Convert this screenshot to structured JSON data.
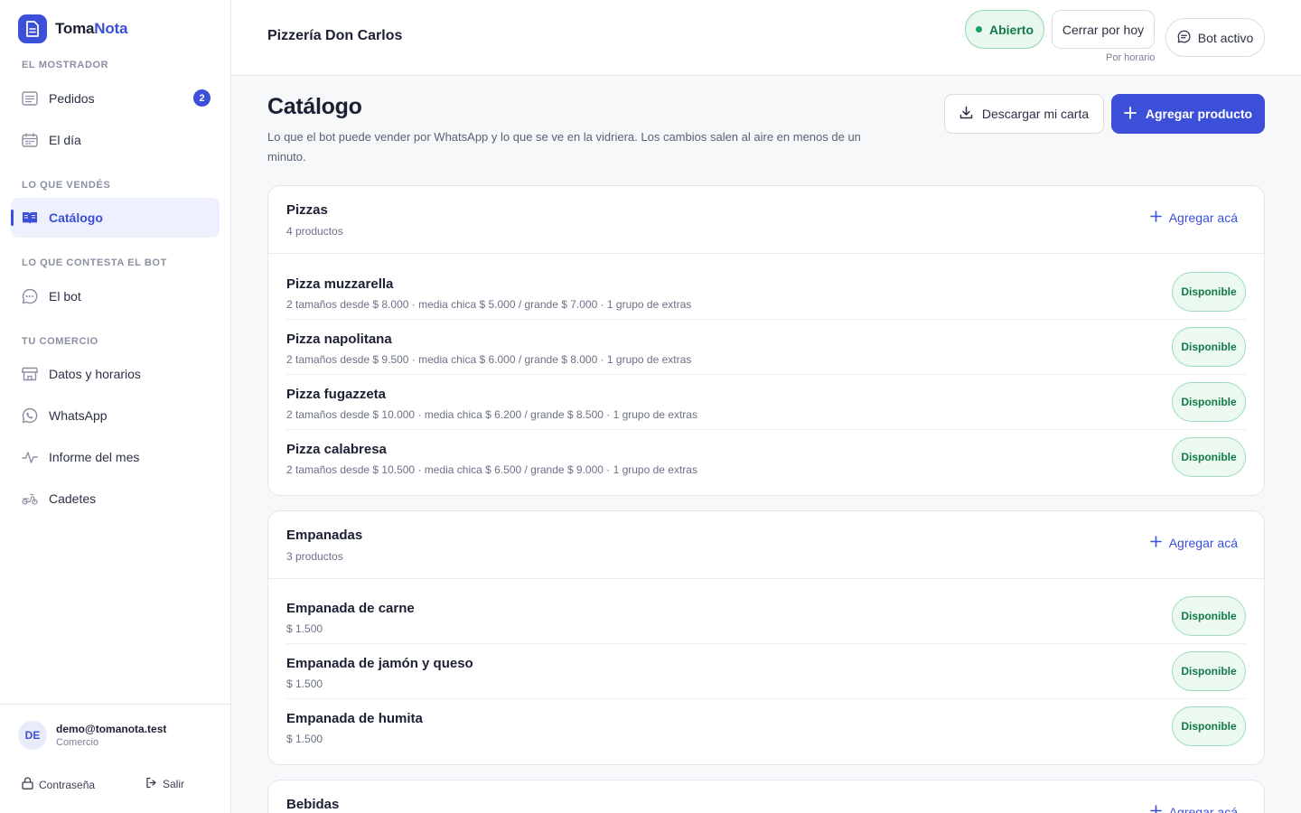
{
  "app": {
    "name_part1": "Toma",
    "name_part2": "Nota"
  },
  "sidebar": {
    "sections": [
      {
        "label": "El mostrador"
      },
      {
        "label": "Lo que vendés"
      },
      {
        "label": "Lo que contesta el bot"
      },
      {
        "label": "Tu comercio"
      }
    ],
    "items": [
      {
        "label": "Pedidos",
        "badge": "2",
        "icon": "list-icon"
      },
      {
        "label": "El día",
        "icon": "calendar-icon"
      },
      {
        "label": "Catálogo",
        "icon": "book-icon",
        "active": true
      },
      {
        "label": "El bot",
        "icon": "chat-bubble-icon"
      },
      {
        "label": "Datos y horarios",
        "icon": "store-icon"
      },
      {
        "label": "WhatsApp",
        "icon": "whatsapp-icon"
      },
      {
        "label": "Informe del mes",
        "icon": "activity-icon"
      },
      {
        "label": "Cadetes",
        "icon": "scooter-icon"
      }
    ],
    "user": {
      "initials": "DE",
      "email": "demo@tomanota.test",
      "role": "Comercio"
    },
    "footer": {
      "password": "Contraseña",
      "logout": "Salir"
    }
  },
  "topbar": {
    "shop_name": "Pizzería Don Carlos",
    "status": "Abierto",
    "close_today": "Cerrar por hoy",
    "schedule_note": "Por horario",
    "bot": "Bot activo"
  },
  "main": {
    "title": "Catálogo",
    "description": "Lo que el bot puede vender por WhatsApp y lo que se ve en la vidriera. Los cambios salen al aire en menos de un minuto.",
    "download_btn": "Descargar mi carta",
    "add_btn": "Agregar producto",
    "add_here": "Agregar acá",
    "available": "Disponible",
    "categories": [
      {
        "name": "Pizzas",
        "count": "4 productos",
        "products": [
          {
            "name": "Pizza muzzarella",
            "meta": "2 tamaños desde  $ 8.000  · media chica $ 5.000 / grande $ 7.000  · 1 grupo de extras"
          },
          {
            "name": "Pizza napolitana",
            "meta": "2 tamaños desde  $ 9.500  · media chica $ 6.000 / grande $ 8.000  · 1 grupo de extras"
          },
          {
            "name": "Pizza fugazzeta",
            "meta": "2 tamaños desde  $ 10.000  · media chica $ 6.200 / grande $ 8.500  · 1 grupo de extras"
          },
          {
            "name": "Pizza calabresa",
            "meta": "2 tamaños desde  $ 10.500  · media chica $ 6.500 / grande $ 9.000  · 1 grupo de extras"
          }
        ]
      },
      {
        "name": "Empanadas",
        "count": "3 productos",
        "products": [
          {
            "name": "Empanada de carne",
            "meta": "$ 1.500"
          },
          {
            "name": "Empanada de jamón y queso",
            "meta": "$ 1.500"
          },
          {
            "name": "Empanada de humita",
            "meta": "$ 1.500"
          }
        ]
      },
      {
        "name": "Bebidas",
        "count": "",
        "products": []
      }
    ]
  },
  "colors": {
    "accent": "#3b4fd8",
    "success": "#1aa260"
  }
}
